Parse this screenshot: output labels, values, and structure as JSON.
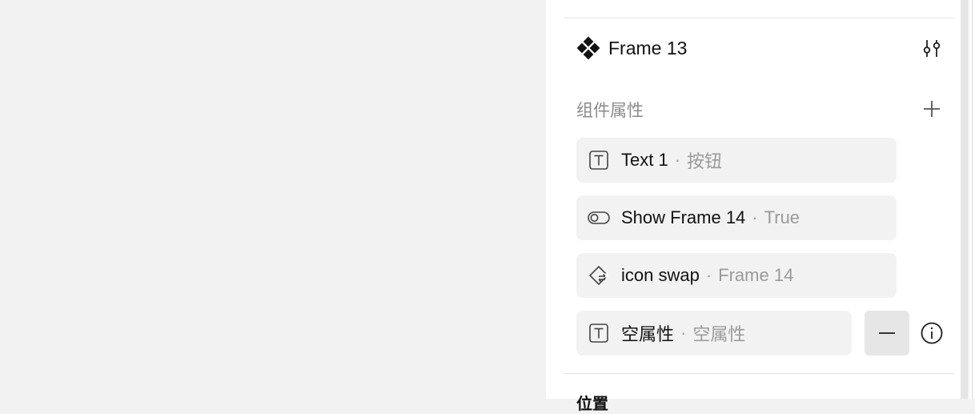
{
  "frame": {
    "name": "Frame 13"
  },
  "component_properties": {
    "label": "组件属性",
    "separator": "·",
    "items": [
      {
        "icon": "text-icon",
        "name": "Text 1",
        "value": "按钮"
      },
      {
        "icon": "toggle-icon",
        "name": "Show Frame 14",
        "value": "True"
      },
      {
        "icon": "instance-swap-icon",
        "name": "icon swap",
        "value": "Frame 14"
      },
      {
        "icon": "text-icon",
        "name": "空属性",
        "value": "空属性"
      }
    ]
  },
  "next_section": {
    "label": "位置"
  }
}
